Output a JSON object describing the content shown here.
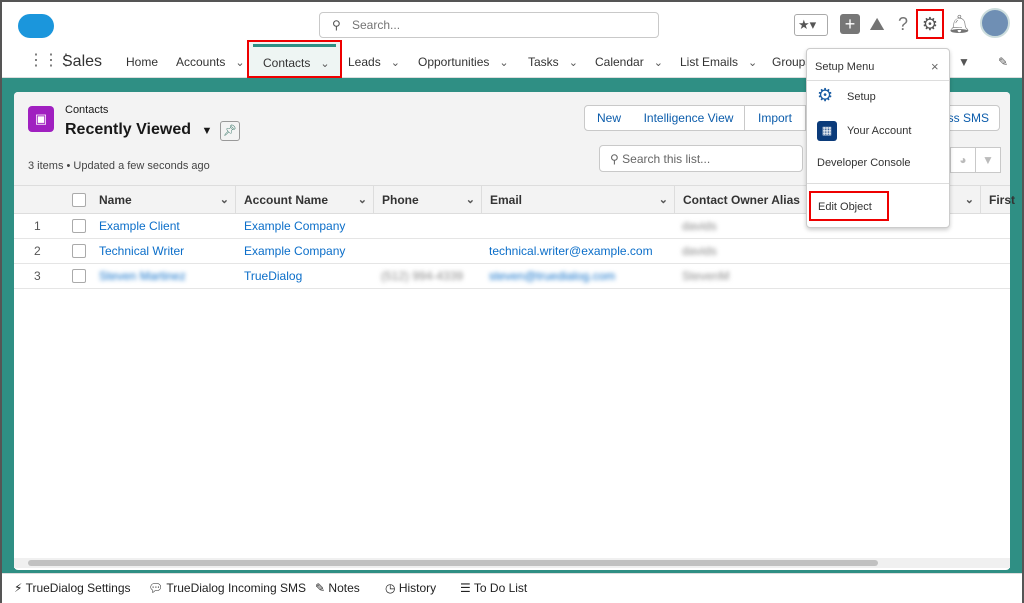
{
  "header": {
    "search_placeholder": "Search...",
    "app_name": "Sales"
  },
  "nav": [
    {
      "label": "Home"
    },
    {
      "label": "Accounts"
    },
    {
      "label": "Contacts"
    },
    {
      "label": "Leads"
    },
    {
      "label": "Opportunities"
    },
    {
      "label": "Tasks"
    },
    {
      "label": "Calendar"
    },
    {
      "label": "List Emails"
    },
    {
      "label": "Groups"
    }
  ],
  "list": {
    "object": "Contacts",
    "view": "Recently Viewed",
    "status": "3 items • Updated a few seconds ago",
    "search_placeholder": "Search this list...",
    "buttons": {
      "new": "New",
      "intelligence": "Intelligence View",
      "import": "Import",
      "sms": "ss SMS"
    },
    "columns": [
      "Name",
      "Account Name",
      "Phone",
      "Email",
      "Contact Owner Alias",
      "First"
    ],
    "rows": [
      {
        "num": "1",
        "name": "Example Client",
        "account": "Example Company",
        "phone": "",
        "email": "",
        "owner": "davids"
      },
      {
        "num": "2",
        "name": "Technical Writer",
        "account": "Example Company",
        "phone": "",
        "email": "technical.writer@example.com",
        "owner": "davids"
      },
      {
        "num": "3",
        "name": "Steven Martinez",
        "account": "TrueDialog",
        "phone": "(512) 994-4339",
        "email": "steven@truedialog.com",
        "owner": "StevenM"
      }
    ]
  },
  "setup_menu": {
    "title": "Setup Menu",
    "items": [
      "Setup",
      "Your Account",
      "Developer Console",
      "Edit Object"
    ]
  },
  "footer": [
    "TrueDialog Settings",
    "TrueDialog Incoming SMS",
    "Notes",
    "History",
    "To Do List"
  ],
  "colors": {
    "accent": "#2f8f84",
    "link": "#0b6ec9",
    "highlight": "#e00000",
    "object_icon": "#a020c0"
  }
}
